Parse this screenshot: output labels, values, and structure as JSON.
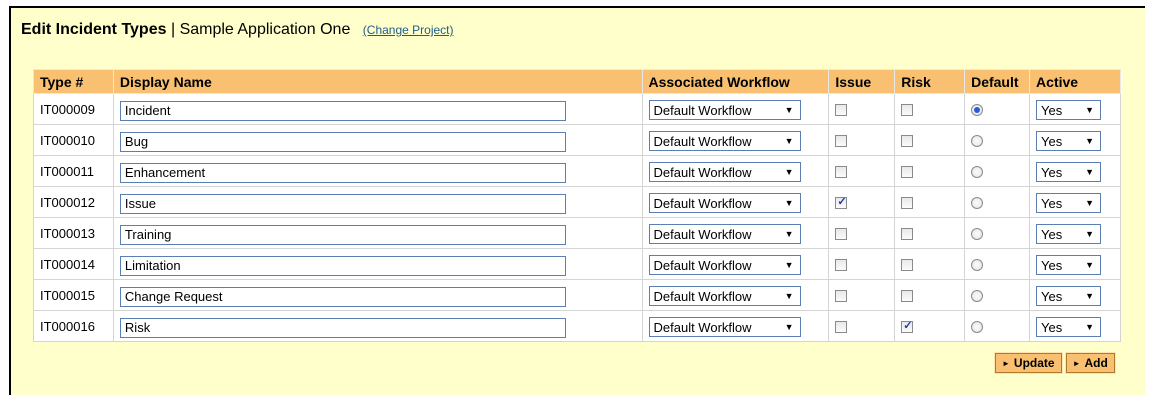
{
  "header": {
    "title": "Edit Incident Types",
    "separator": "|",
    "project": "Sample Application One",
    "change_link": "(Change Project)"
  },
  "columns": [
    "Type #",
    "Display Name",
    "Associated Workflow",
    "Issue",
    "Risk",
    "Default",
    "Active"
  ],
  "rows": [
    {
      "type_no": "IT000009",
      "name": "Incident",
      "workflow": "Default Workflow",
      "issue": false,
      "risk": false,
      "default": true,
      "active": "Yes"
    },
    {
      "type_no": "IT000010",
      "name": "Bug",
      "workflow": "Default Workflow",
      "issue": false,
      "risk": false,
      "default": false,
      "active": "Yes"
    },
    {
      "type_no": "IT000011",
      "name": "Enhancement",
      "workflow": "Default Workflow",
      "issue": false,
      "risk": false,
      "default": false,
      "active": "Yes"
    },
    {
      "type_no": "IT000012",
      "name": "Issue",
      "workflow": "Default Workflow",
      "issue": true,
      "risk": false,
      "default": false,
      "active": "Yes"
    },
    {
      "type_no": "IT000013",
      "name": "Training",
      "workflow": "Default Workflow",
      "issue": false,
      "risk": false,
      "default": false,
      "active": "Yes"
    },
    {
      "type_no": "IT000014",
      "name": "Limitation",
      "workflow": "Default Workflow",
      "issue": false,
      "risk": false,
      "default": false,
      "active": "Yes"
    },
    {
      "type_no": "IT000015",
      "name": "Change Request",
      "workflow": "Default Workflow",
      "issue": false,
      "risk": false,
      "default": false,
      "active": "Yes"
    },
    {
      "type_no": "IT000016",
      "name": "Risk",
      "workflow": "Default Workflow",
      "issue": false,
      "risk": true,
      "default": false,
      "active": "Yes"
    }
  ],
  "buttons": {
    "update": "Update",
    "add": "Add",
    "arrow_icon": "triangle-right-icon"
  },
  "colors": {
    "panel_bg": "#ffffcc",
    "header_bg": "#f8c070",
    "link": "#1f5c8c"
  }
}
